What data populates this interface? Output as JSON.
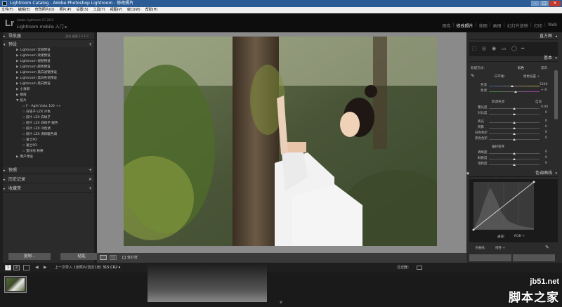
{
  "window": {
    "title": "Lightroom Catalog - Adobe Photoshop Lightroom - 修改照片",
    "controls": [
      "–",
      "□",
      "✕"
    ]
  },
  "menu": [
    "文件(F)",
    "编辑(E)",
    "修改照片(D)",
    "照片(P)",
    "设置(S)",
    "工具(T)",
    "视图(V)",
    "窗口(W)",
    "帮助(H)"
  ],
  "identity": {
    "logo": "Lr",
    "version": "Adobe Lightroom CC 2015",
    "mobile": "Lightroom mobile 入门 ▸"
  },
  "modules": [
    "图库",
    "修改照片",
    "地图",
    "画册",
    "幻灯片放映",
    "打印",
    "Web"
  ],
  "active_module": "修改照片",
  "left_panel": {
    "navigator": {
      "label": "导航器",
      "options": "适合  填满  1:1  1:2"
    },
    "presets": {
      "label": "预设",
      "add": "+"
    },
    "preset_groups": [
      "Lightroom 常规预设",
      "Lightroom 效果预设",
      "Lightroom 视频预设",
      "Lightroom 颜色预设",
      "Lightroom 黑白滤镜预设",
      "Lightroom 黑白色调预设",
      "Lightroom 黑白预设",
      "小清新",
      "橙底"
    ],
    "film_group": "胶片",
    "film_items": [
      "F - Agfa Vista 100 ++",
      "白噪子 LZX 冷色",
      "胶片 LZX 白嗦子",
      "胶片 LZX 白嗦子 暖色",
      "胶片 LZX 冷色调",
      "胶片 LZX 清新暖色调",
      "富士PO",
      "富士PO",
      "蜜纹绘 粉棒"
    ],
    "user_group": "用户预设",
    "snapshots": "快照",
    "history": "历史记录",
    "collections": "收藏夹",
    "copy_button": "复制...",
    "paste_button": "粘贴"
  },
  "toolbar": {
    "soft_proof": "软打样",
    "view2": "Y|Y"
  },
  "right_panel": {
    "histogram_label": "直方图",
    "basic_label": "基本",
    "treatment_label": "处理方式：",
    "treatment_color": "彩色",
    "treatment_bw": "黑白",
    "wb_label": "白平衡：",
    "wb_value": "原始设置 ÷",
    "temp_label": "色温",
    "temp_value": "5200",
    "temp_pos": 0.46,
    "tint_label": "色调",
    "tint_value": "+ 8",
    "tint_pos": 0.53,
    "tone_label": "影调色调",
    "auto_label": "自动",
    "tone_sliders": [
      {
        "label": "曝光度",
        "value": "0.00",
        "pos": 0.5
      },
      {
        "label": "对比度",
        "value": "0",
        "pos": 0.5
      },
      {
        "label": "高光",
        "value": "0",
        "pos": 0.5
      },
      {
        "label": "阴影",
        "value": "0",
        "pos": 0.5
      },
      {
        "label": "白色色阶",
        "value": "0",
        "pos": 0.5
      },
      {
        "label": "黑色色阶",
        "value": "0",
        "pos": 0.5
      }
    ],
    "presence_label": "偏好程序",
    "presence_sliders": [
      {
        "label": "清晰度",
        "value": "0",
        "pos": 0.5
      },
      {
        "label": "鲜艳度",
        "value": "0",
        "pos": 0.5
      },
      {
        "label": "饱和度",
        "value": "0",
        "pos": 0.5
      }
    ],
    "curve_label": "色调曲线",
    "curve_channel_label": "通道：",
    "curve_channel": "RGB ÷",
    "point_curve_label": "点曲线：",
    "point_curve_value": "线性 ÷"
  },
  "filmstrip": {
    "page1": "1",
    "page2": "2",
    "path_prefix": "上一次导入",
    "path_count": "1张照片/选定1张/",
    "path_file": "315.CR2 ▾",
    "filter_label": "过滤器："
  },
  "watermark": {
    "en": "jb51.net",
    "zh": "脚本之家"
  },
  "colors": {
    "titlebar": "#2b5c96",
    "panel_bg": "#2b2b2b",
    "canvas_bg": "#8a8a8a"
  }
}
